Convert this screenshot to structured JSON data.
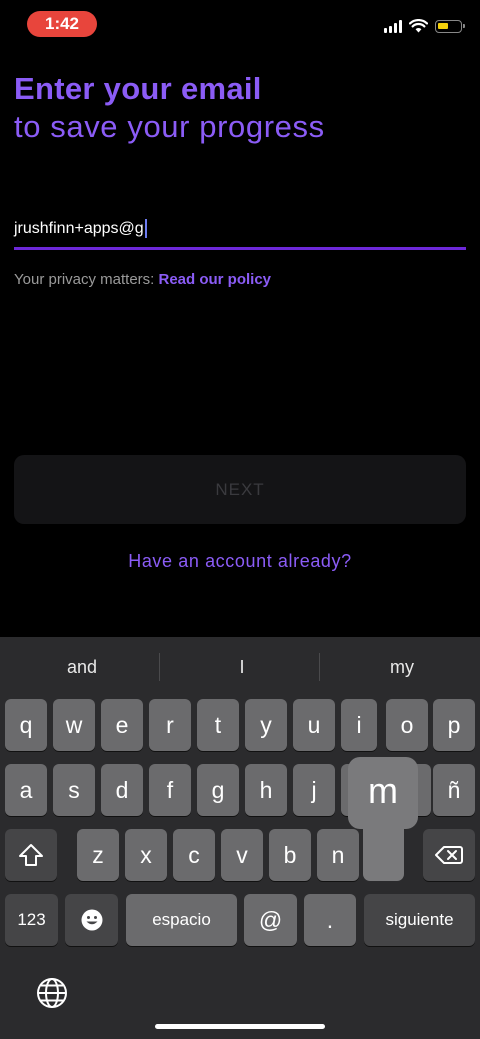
{
  "status_bar": {
    "time": "1:42"
  },
  "header": {
    "title_bold": "Enter your email",
    "title_light": "to save your progress"
  },
  "email": {
    "value": "jrushfinn+apps@g"
  },
  "privacy": {
    "prefix": "Your privacy matters: ",
    "link": "Read our policy"
  },
  "next_button": {
    "label": "NEXT"
  },
  "have_account": {
    "label": "Have an account already?"
  },
  "keyboard": {
    "suggestions": [
      "and",
      "I",
      "my"
    ],
    "row1": [
      "q",
      "w",
      "e",
      "r",
      "t",
      "y",
      "u",
      "i",
      "o",
      "p"
    ],
    "row2": [
      "a",
      "s",
      "d",
      "f",
      "g",
      "h",
      "j",
      "k",
      "l",
      "ñ"
    ],
    "row3": [
      "z",
      "x",
      "c",
      "v",
      "b",
      "n",
      "m"
    ],
    "numbers_key": "123",
    "space_key": "espacio",
    "at_key": "@",
    "dot_key": ".",
    "return_key": "siguiente",
    "popup_letter": "m"
  },
  "colors": {
    "accent": "#8b5cf6",
    "underline": "#6d28d9",
    "status_pill": "#e8453c"
  }
}
